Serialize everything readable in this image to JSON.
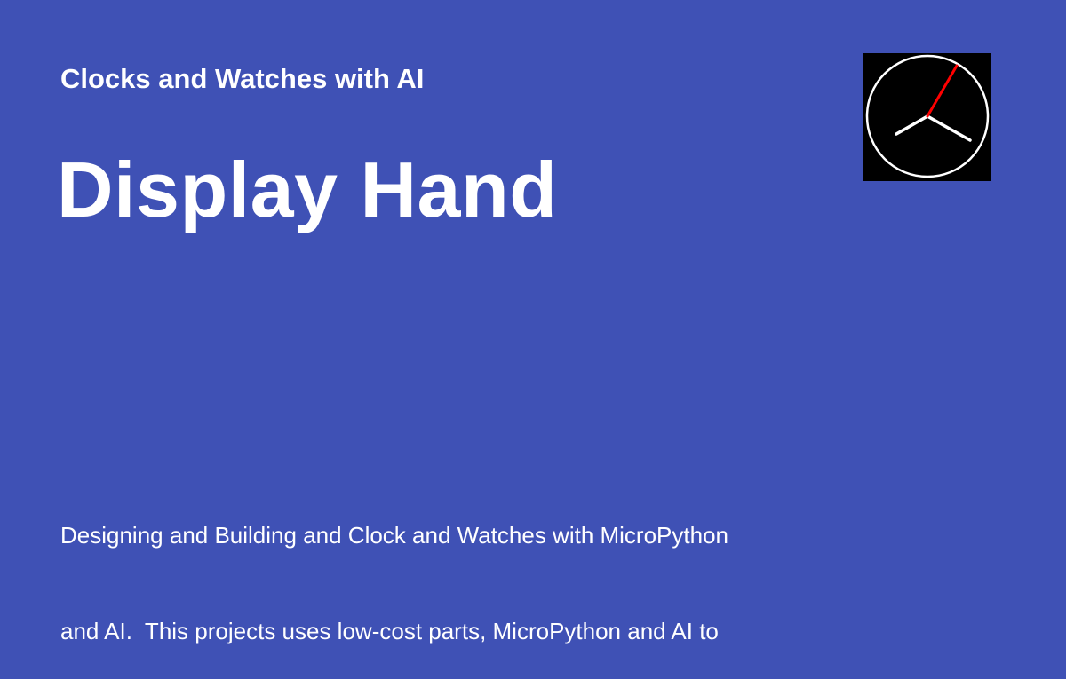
{
  "header": {
    "site_name": "Clocks and Watches with AI"
  },
  "page": {
    "title": "Display Hand",
    "description_line1": "Designing and Building and Clock and Watches with MicroPython",
    "description_line2": "and AI.  This projects uses low-cost parts, MicroPython and AI to"
  },
  "logo": {
    "icon": "analog-clock-icon",
    "background_color": "#000000",
    "face_color": "#ffffff",
    "hour_minute_hand_color": "#ffffff",
    "second_hand_color": "#ff0000"
  },
  "theme": {
    "background_color": "#3f51b5",
    "text_color": "#ffffff"
  }
}
